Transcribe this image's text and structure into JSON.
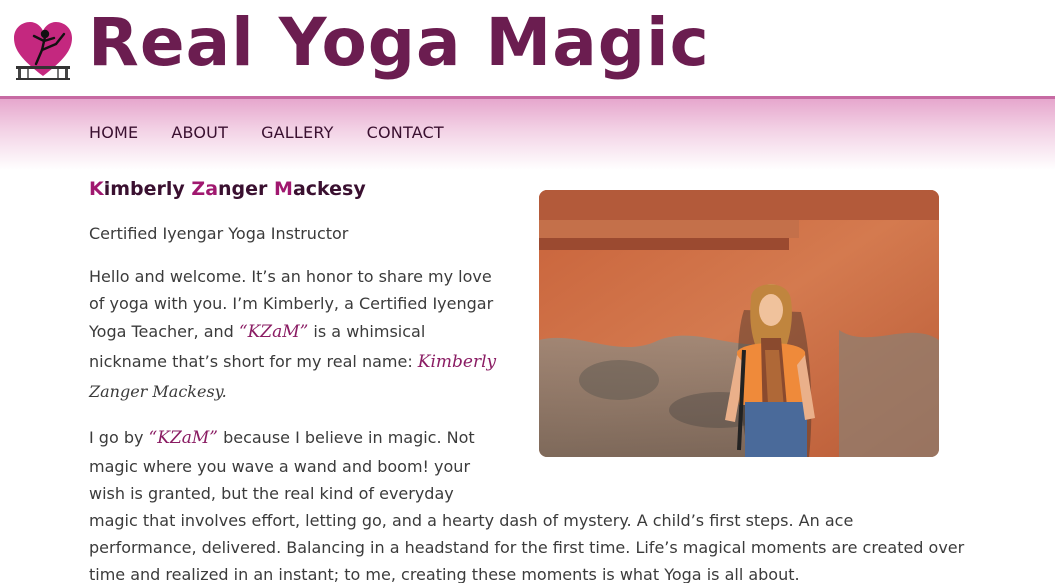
{
  "site": {
    "title": "Real Yoga Magic"
  },
  "nav": {
    "items": [
      "HOME",
      "ABOUT",
      "GALLERY",
      "CONTACT"
    ]
  },
  "heading": {
    "k": "K",
    "kimberly_rest": "imberly ",
    "z": "Za",
    "zanger_rest": "nger ",
    "m": "M",
    "mackesy_rest": "ackesy"
  },
  "subtitle": "Certified Iyengar Yoga Instructor",
  "para1": {
    "l1": "Hello and welcome. It’s an honor to share my love",
    "l2": "of yoga with you. I’m Kimberly, a Certified Iyengar",
    "l3a": "Yoga Teacher, and ",
    "l3b": "“KZaM”",
    "l3c": " is a whimsical",
    "l4a": "nickname that’s short for my real name: ",
    "l4b": "Kimberly",
    "l5": "Zanger Mackesy."
  },
  "para2": {
    "l1a": "I go by ",
    "l1b": "“KZaM”",
    "l1c": " because I believe in magic. Not",
    "l2": "magic where you wave a wand and boom! your",
    "l3": "wish is granted, but the real kind of everyday",
    "l4": "magic that involves effort, letting go, and a hearty dash of mystery. A child’s first steps. An ace",
    "l5": "performance, delivered. Balancing in a headstand for the first time. Life’s magical moments are created over",
    "l6": "time and realized in an instant; to me, creating these moments is what Yoga is all about."
  },
  "colors": {
    "brand": "#6b1d50",
    "accent": "#a0186f",
    "nav_band": "#e6a7cd"
  }
}
